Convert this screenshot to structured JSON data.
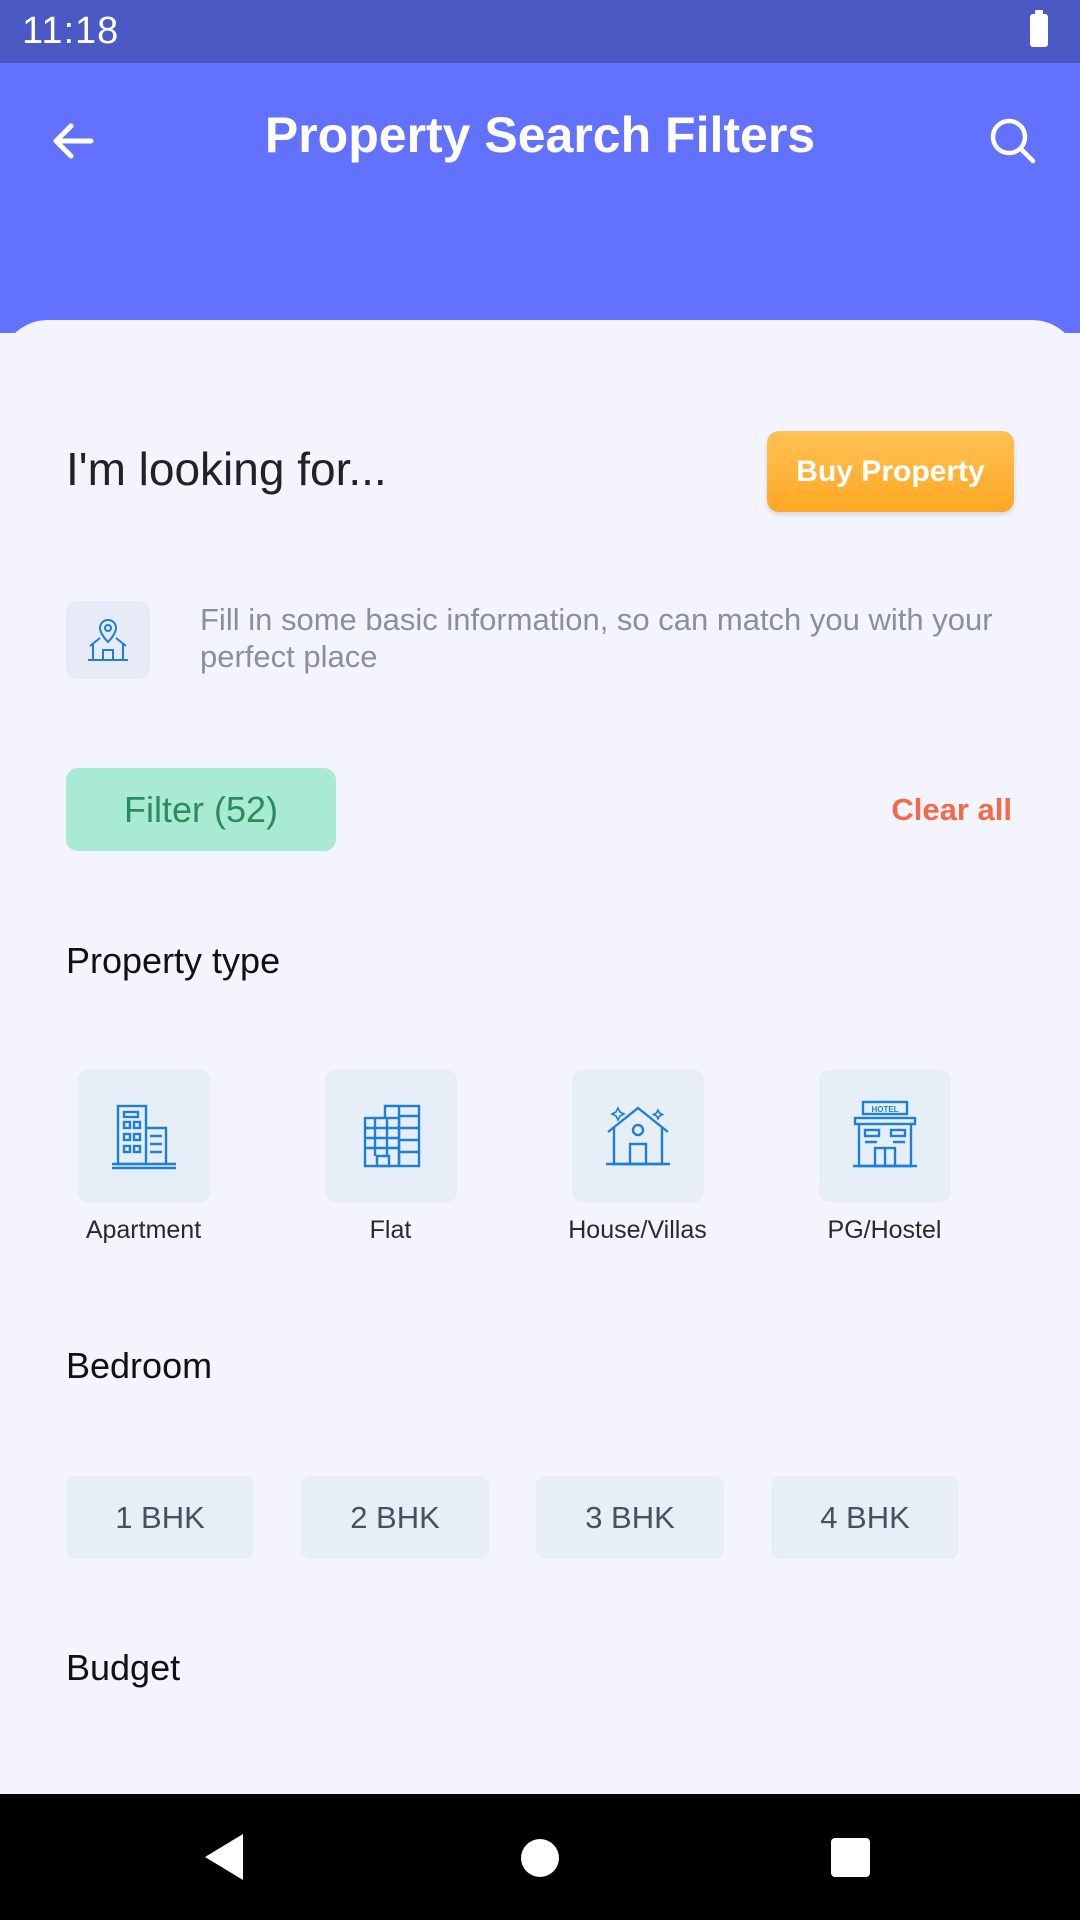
{
  "status_bar": {
    "time": "11:18"
  },
  "header": {
    "title": "Property Search Filters",
    "back_icon": "arrow-left-icon",
    "search_icon": "search-icon"
  },
  "intro": {
    "heading": "I'm looking for...",
    "buy_button": "Buy Property",
    "info_text": "Fill in some basic information, so can match you with your perfect place"
  },
  "filters": {
    "filter_label": "Filter (52)",
    "clear_label": "Clear all"
  },
  "property_type": {
    "title": "Property type",
    "items": [
      {
        "label": "Apartment",
        "icon": "apartment-icon"
      },
      {
        "label": "Flat",
        "icon": "flat-icon"
      },
      {
        "label": "House/Villas",
        "icon": "house-icon"
      },
      {
        "label": "PG/Hostel",
        "icon": "hostel-icon",
        "sign_text": "HOTEL"
      }
    ]
  },
  "bedroom": {
    "title": "Bedroom",
    "options": [
      "1 BHK",
      "2 BHK",
      "3 BHK",
      "4 BHK"
    ]
  },
  "budget": {
    "title": "Budget"
  },
  "colors": {
    "primary": "#6372fe",
    "status_bar": "#4a59c3",
    "accent": "#ffa724",
    "clear": "#f26a46",
    "icon_blue": "#1f7fd6"
  }
}
